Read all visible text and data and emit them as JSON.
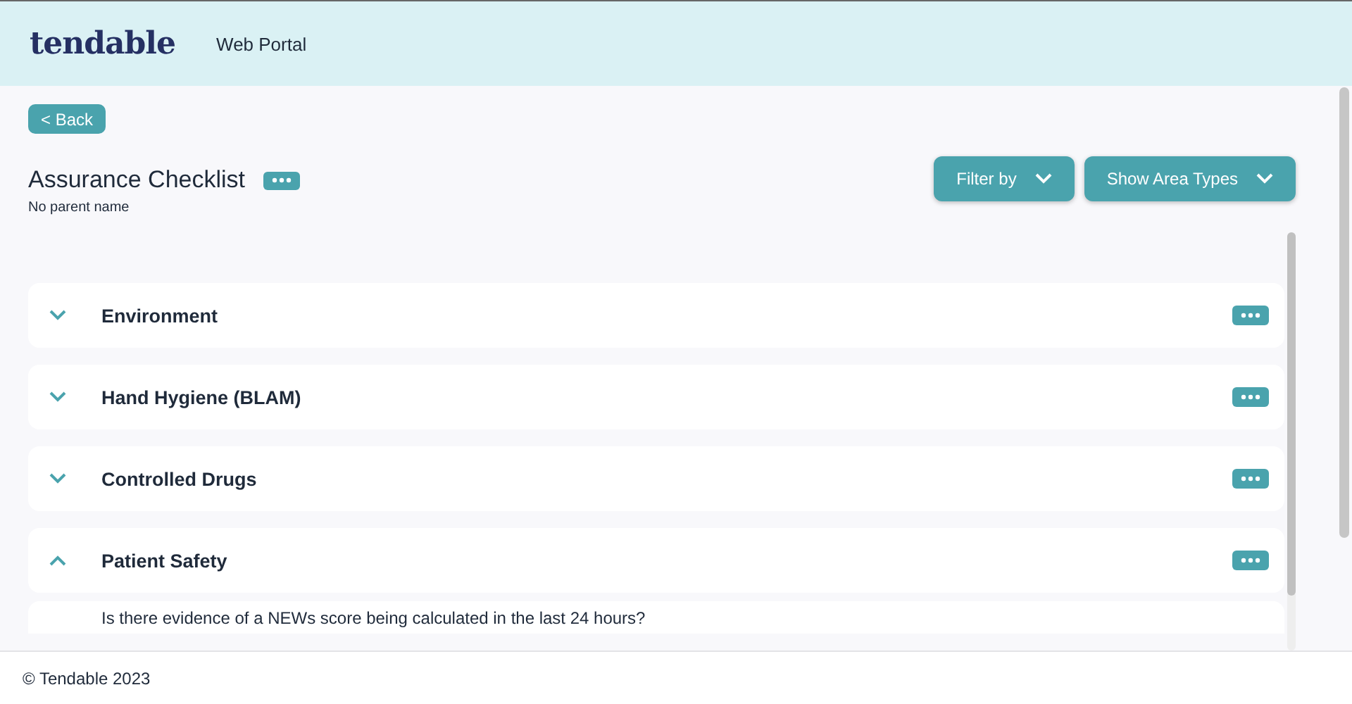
{
  "header": {
    "logo": "tendable",
    "title": "Web Portal"
  },
  "back_button": "< Back",
  "checklist": {
    "title": "Assurance Checklist",
    "subtitle": "No parent name"
  },
  "toolbar": [
    {
      "label": "Filter by"
    },
    {
      "label": "Show Area Types"
    }
  ],
  "sections": [
    {
      "name": "Environment",
      "expanded": false
    },
    {
      "name": "Hand Hygiene (BLAM)",
      "expanded": false
    },
    {
      "name": "Controlled Drugs",
      "expanded": false
    },
    {
      "name": "Patient Safety",
      "expanded": true,
      "questions": [
        "Is there evidence of a NEWs score being calculated in the last 24 hours?"
      ]
    }
  ],
  "footer": "© Tendable 2023"
}
